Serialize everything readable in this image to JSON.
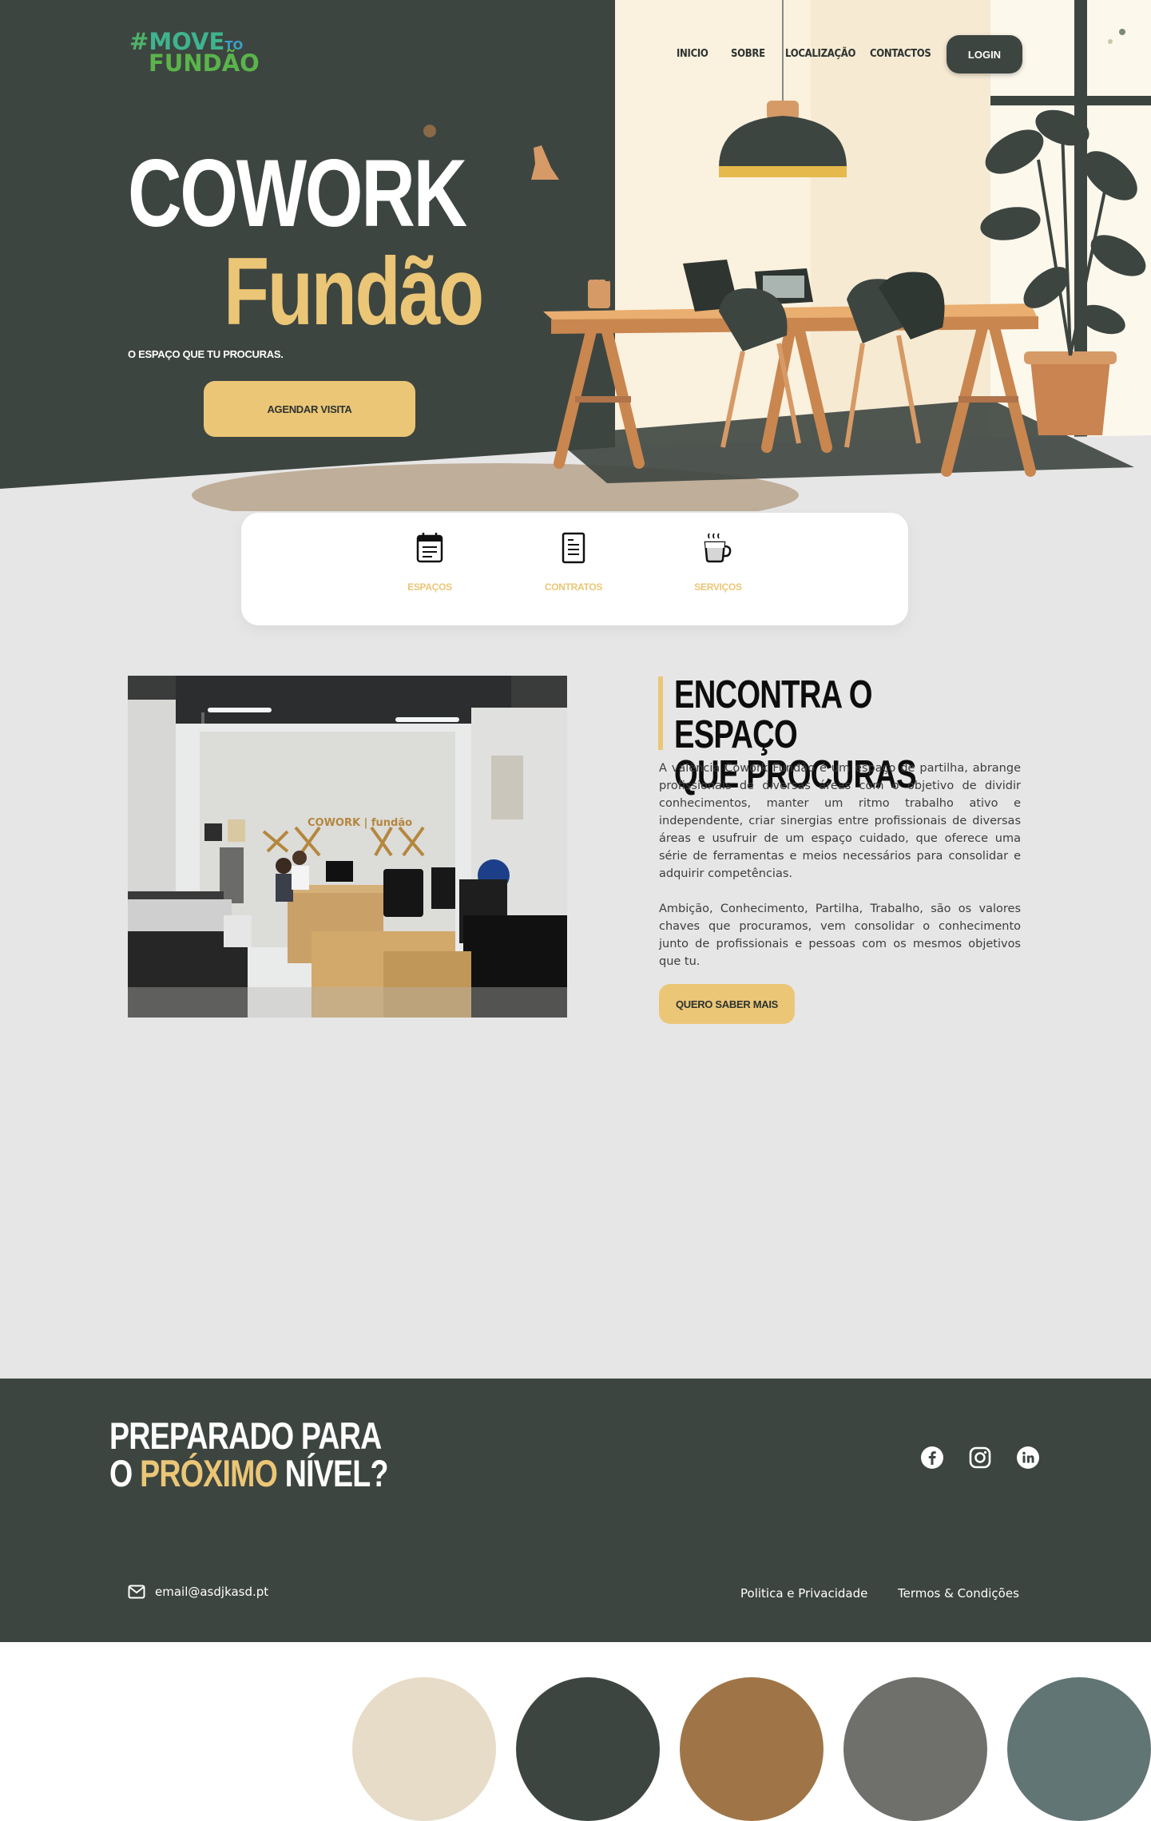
{
  "header": {
    "logo": {
      "line1_hash": "#",
      "line1_word": "MOVE",
      "line1_small": "TO",
      "line2": "FUNDÃO"
    },
    "nav": [
      {
        "label": "INICIO"
      },
      {
        "label": "SOBRE"
      },
      {
        "label": "LOCALIZAÇÃO"
      },
      {
        "label": "CONTACTOS"
      }
    ],
    "login_label": "LOGIN"
  },
  "hero": {
    "title": "COWORK",
    "subtitle": "Fundão",
    "tagline": "O ESPAÇO QUE TU PROCURAS.",
    "cta_label": "AGENDAR VISITA"
  },
  "features": [
    {
      "label": "ESPAÇOS",
      "icon": "calendar-icon"
    },
    {
      "label": "CONTRATOS",
      "icon": "document-icon"
    },
    {
      "label": "SERVIÇOS",
      "icon": "coffee-cup-icon"
    }
  ],
  "about": {
    "title": "ENCONTRA O ESPAÇO\nQUE PROCURAS",
    "paragraph1": "A valência Cowork Fundão é um espaço de partilha, abrange profissionais de diversas áreas com o objetivo de dividir conhecimentos, manter um ritmo trabalho ativo e independente, criar sinergias entre profissionais de diversas áreas e usufruir de um espaço cuidado,  que oferece uma série de ferramentas e meios necessários para consolidar e adquirir competências.",
    "paragraph2": "Ambição, Conhecimento, Partilha, Trabalho, são os valores chaves que procuramos, vem consolidar o conhecimento junto de profissionais e pessoas com os mesmos objetivos que tu.",
    "cta_label": "QUERO SABER MAIS",
    "photo_sign": "COWORK | fundão"
  },
  "footer": {
    "title_line1": "PREPARADO PARA",
    "title_line2_prefix": "O ",
    "title_line2_accent": "PRÓXIMO",
    "title_line2_suffix": " NÍVEL?",
    "social": [
      "facebook-icon",
      "instagram-icon",
      "linkedin-icon"
    ],
    "email": "email@asdjkasd.pt",
    "privacy_label": "Politica e Privacidade",
    "terms_label": "Termos & Condições"
  },
  "palette": [
    "#e6dcc7",
    "#3d4540",
    "#9f7547",
    "#6f706c",
    "#627575"
  ],
  "colors": {
    "dark": "#3d4540",
    "accent": "#ebc676",
    "background": "#e6e6e6"
  }
}
